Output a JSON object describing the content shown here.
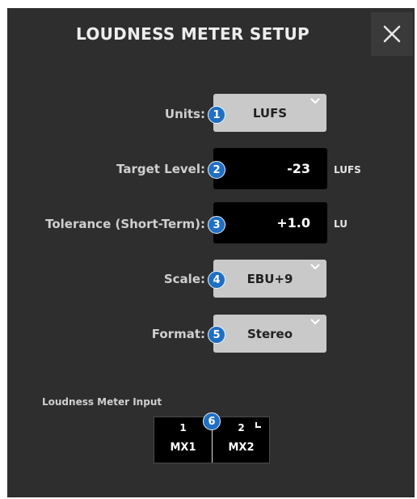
{
  "dialog": {
    "title": "LOUDNESS METER SETUP",
    "close_icon": "close-x-icon"
  },
  "fields": {
    "units": {
      "label": "Units:",
      "value": "LUFS",
      "badge": "1"
    },
    "target_level": {
      "label": "Target Level:",
      "value": "-23",
      "unit": "LUFS",
      "badge": "2"
    },
    "tolerance": {
      "label": "Tolerance (Short-Term):",
      "value": "+1.0",
      "unit": "LU",
      "badge": "3"
    },
    "scale": {
      "label": "Scale:",
      "value": "EBU+9",
      "badge": "4"
    },
    "format": {
      "label": "Format:",
      "value": "Stereo",
      "badge": "5"
    }
  },
  "input": {
    "label": "Loudness Meter Input",
    "badge": "6",
    "channels": [
      {
        "number": "1",
        "name": "MX1"
      },
      {
        "number": "2",
        "name": "MX2"
      }
    ]
  },
  "colors": {
    "panel_bg": "#2e2e2e",
    "dropdown_bg": "#c9c9c9",
    "badge_bg": "#1f6fc4"
  }
}
